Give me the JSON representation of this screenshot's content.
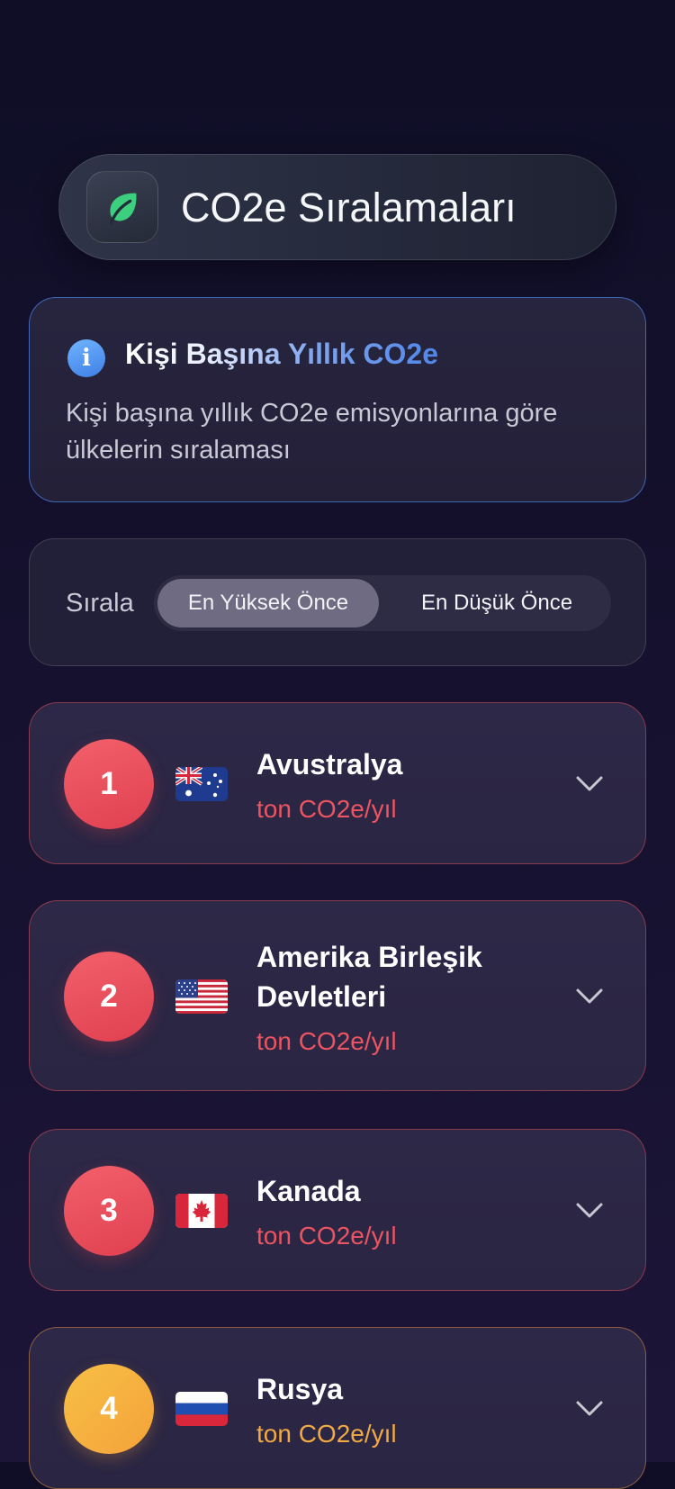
{
  "header": {
    "title": "CO2e Sıralamaları",
    "icon": "leaf-icon",
    "icon_color": "#3ccf7e"
  },
  "info": {
    "icon": "info-icon",
    "title": "Kişi Başına Yıllık CO2e",
    "description": "Kişi başına yıllık CO2e emisyonlarına göre ülkelerin sıralaması"
  },
  "sort": {
    "label": "Sırala",
    "options": [
      {
        "label": "En Yüksek Önce",
        "selected": true
      },
      {
        "label": "En Düşük Önce",
        "selected": false
      }
    ]
  },
  "rankings": [
    {
      "rank": "1",
      "country": "Avustralya",
      "flag": "flag-australia",
      "unit": "ton CO2e/yıl",
      "color": "#e94b5a"
    },
    {
      "rank": "2",
      "country": "Amerika Birleşik Devletleri",
      "flag": "flag-usa",
      "unit": "ton CO2e/yıl",
      "color": "#e94b5a"
    },
    {
      "rank": "3",
      "country": "Kanada",
      "flag": "flag-canada",
      "unit": "ton CO2e/yıl",
      "color": "#e94b5a"
    },
    {
      "rank": "4",
      "country": "Rusya",
      "flag": "flag-russia",
      "unit": "ton CO2e/yıl",
      "color": "#f0a943"
    }
  ]
}
